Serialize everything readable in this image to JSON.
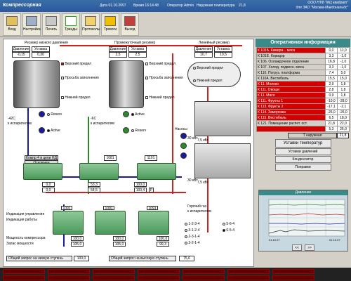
{
  "titlebar": {
    "title": "Компрессорная",
    "date": "Дата  01.10.2007",
    "time": "Время  16:14:48",
    "operator": "Оператор  Admin",
    "outdoor": "Наружная температура",
    "outdoor_val": "21,8",
    "company1": "ООО НТФ \"МЦ квадрат\"",
    "company2": "для ЗАО \"Москва-Макдональдс\""
  },
  "toolbar": [
    {
      "label": "Вход",
      "icon": "key-icon"
    },
    {
      "label": "Настройка",
      "icon": "settings-icon"
    },
    {
      "label": "Печать",
      "icon": "printer-icon"
    },
    {
      "label": "Тренды",
      "icon": "trend-icon"
    },
    {
      "label": "Протоколы",
      "icon": "folder-icon"
    },
    {
      "label": "Тревоги",
      "icon": "bell-icon"
    },
    {
      "label": "Выход",
      "icon": "exit-icon"
    }
  ],
  "receiver_low": {
    "title": "Ресивер низкого давления",
    "h1": "Давление",
    "h2": "Уставка",
    "v1": "-0,15",
    "v2": "0,30"
  },
  "receiver_mid": {
    "title": "Промежуточный ресивер",
    "h1": "Давление",
    "h2": "Уставка",
    "v1": "2,5",
    "v2": "2,5"
  },
  "receiver_line": {
    "title": "Линейный ресивер",
    "h1": "Давление",
    "h2": "Уставка",
    "v1": "10,7",
    "v2": "10,5"
  },
  "levels": {
    "upper": "Верхний предел",
    "request": "Просьба заполнения",
    "lower": "Нижний предел"
  },
  "pumps": {
    "reserv": "Reserv",
    "active": "Active",
    "temp1": "-42C",
    "temp1_sub": "к испарителям",
    "temp2": "-6C",
    "temp2_sub": "к испарителям",
    "label": "Насосы"
  },
  "compressors": {
    "group_label": "Компр 4 в цепи НД",
    "group_state": "Отключен",
    "ids_top": [
      "1081",
      "1101"
    ],
    "vals_top_a": [
      "0,0",
      "53,3",
      "100,0"
    ],
    "vals_top_b": [
      "0,0",
      "54,5",
      "100,4"
    ],
    "ids_bottom": [
      "1091",
      "1091",
      "1091"
    ],
    "vals_bottom_a": [
      "100,0",
      "100,0",
      "100,0"
    ],
    "vals_bottom_b": [
      "105,0",
      "105,0",
      "99,3"
    ],
    "p_tag": "P"
  },
  "fans": {
    "kw1": "30 кВт",
    "kw2": "7,5 кВт",
    "kw3": "30 кВт",
    "kw4": "7,5 кВт"
  },
  "hot_gas": {
    "line1": "Горячий газ",
    "line2": "к испарителям"
  },
  "sequences": [
    {
      "label": "1-2-3-4",
      "on": false
    },
    {
      "label": "3-1-2-4",
      "on": false
    },
    {
      "label": "2-3-1-4",
      "on": false
    },
    {
      "label": "3-2-1-4",
      "on": false
    },
    {
      "label": "5-6-4",
      "on": false
    },
    {
      "label": "6-5-4",
      "on": true
    }
  ],
  "legend_rows": [
    "Индикация управления",
    "Индикация работы",
    "Мощность компрессора",
    "Запас мощности"
  ],
  "bottom": {
    "low_label": "Общий запрос на низкую ступень",
    "low_val": "100,0",
    "high_label": "Общий запрос на высокую ступень",
    "high_val": "75,6"
  },
  "ops": {
    "title": "Оперативная информация",
    "rows": [
      {
        "name": "К 101Б. Камера... мяса",
        "v1": "0,0",
        "v2": "11,0",
        "alarm": true
      },
      {
        "name": "К 101Е. Коридор",
        "v1": "3,3",
        "v2": "-1,0",
        "alarm": false
      },
      {
        "name": "К 106. Охлаждочное отделение",
        "v1": "16,8",
        "v2": "-1,0",
        "alarm": false
      },
      {
        "name": "К 107. Холод. подвесн. мяса",
        "v1": "3,3",
        "v2": "-1,0",
        "alarm": false
      },
      {
        "name": "К 110. Погруз. платформа",
        "v1": "7,4",
        "v2": "5,0",
        "alarm": false
      },
      {
        "name": "К 110А. Вестибюль",
        "v1": "15,5",
        "v2": "15,0",
        "alarm": false
      },
      {
        "name": "К 11. Молоко",
        "v1": "2,9",
        "v2": "1,8",
        "alarm": true
      },
      {
        "name": "К 111. Овощи",
        "v1": "2,8",
        "v2": "1,8",
        "alarm": true
      },
      {
        "name": "К 11. Мясо",
        "v1": "0,9",
        "v2": "1,8",
        "alarm": true
      },
      {
        "name": "К 111. Фрукты 1",
        "v1": "-10,0",
        "v2": "-28,0",
        "alarm": true
      },
      {
        "name": "К 113. Фрукты 2",
        "v1": "-17,1",
        "v2": "-2,1",
        "alarm": true
      },
      {
        "name": "К 114. Заморозка",
        "v1": "-26,0",
        "v2": "-26,0",
        "alarm": true
      },
      {
        "name": "К 115. Вестибюль",
        "v1": "6,5",
        "v2": "18,0",
        "alarm": true
      },
      {
        "name": "К 121. Помещение распет. ост.",
        "v1": "21,8",
        "v2": "22,0",
        "alarm": false
      },
      {
        "name": "",
        "v1": "5,3",
        "v2": "26,0",
        "alarm": true
      }
    ],
    "outdoor_label": "Т наружная",
    "outdoor_val": "21,8"
  },
  "right_buttons": {
    "temps": "Уставки температур",
    "pressures": "Уставки давлений",
    "condenser": "Конденсатор",
    "edits": "Поправки"
  },
  "trend": {
    "title": "Давление",
    "date1": "01.10.07",
    "date2": "01.10.07",
    "prev": "<<",
    "next": ">>"
  }
}
